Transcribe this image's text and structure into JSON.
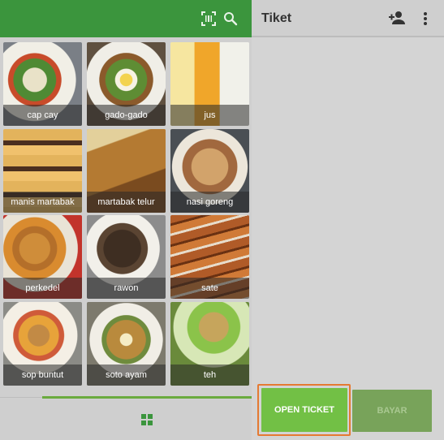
{
  "header": {
    "title": "Tiket",
    "icons": [
      "barcode-scan-icon",
      "search-icon",
      "add-person-icon",
      "more-vert-icon"
    ]
  },
  "products": [
    {
      "name": "cap cay"
    },
    {
      "name": "gado-gado"
    },
    {
      "name": "jus"
    },
    {
      "name": "manis martabak"
    },
    {
      "name": "martabak telur"
    },
    {
      "name": "nasi goreng"
    },
    {
      "name": "perkedel"
    },
    {
      "name": "rawon"
    },
    {
      "name": "sate"
    },
    {
      "name": "sop buntut"
    },
    {
      "name": "soto ayam"
    },
    {
      "name": "teh"
    }
  ],
  "actions": {
    "open_ticket": "OPEN TICKET",
    "pay": "BAYAR"
  },
  "colors": {
    "brand_green": "#3b953d",
    "button_green": "#72c045",
    "highlight_orange": "#e57a32"
  }
}
